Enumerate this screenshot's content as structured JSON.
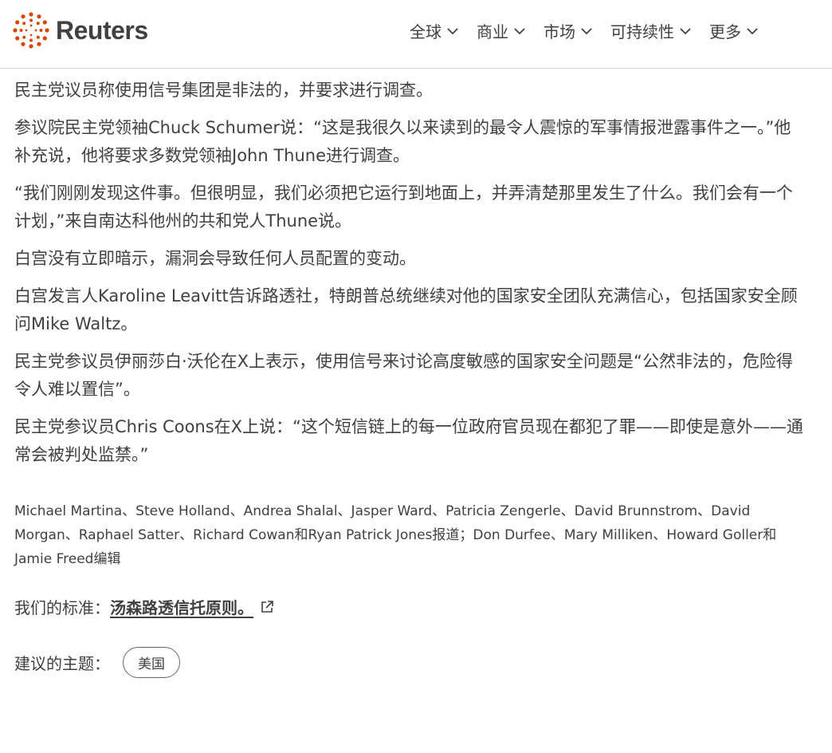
{
  "header": {
    "logo_text": "Reuters",
    "brand_color": "#dc4405",
    "nav": [
      {
        "label": "全球"
      },
      {
        "label": "商业"
      },
      {
        "label": "市场"
      },
      {
        "label": "可持续性"
      },
      {
        "label": "更多"
      }
    ]
  },
  "article": {
    "paragraphs": [
      "民主党议员称使用信号集团是非法的，并要求进行调查。",
      "参议院民主党领袖Chuck Schumer说：“这是我很久以来读到的最令人震惊的军事情报泄露事件之一。”他补充说，他将要求多数党领袖John Thune进行调查。",
      "“我们刚刚发现这件事。但很明显，我们必须把它运行到地面上，并弄清楚那里发生了什么。我们会有一个计划，”来自南达科他州的共和党人Thune说。",
      "白宫没有立即暗示，漏洞会导致任何人员配置的变动。",
      "白宫发言人Karoline Leavitt告诉路透社，特朗普总统继续对他的国家安全团队充满信心，包括国家安全顾问Mike Waltz。",
      "民主党参议员伊丽莎白·沃伦在X上表示，使用信号来讨论高度敏感的国家安全问题是“公然非法的，危险得令人难以置信”。",
      "民主党参议员Chris Coons在X上说：“这个短信链上的每一位政府官员现在都犯了罪——即使是意外——通常会被判处监禁。”"
    ],
    "credits": "Michael Martina、Steve Holland、Andrea Shalal、Jasper Ward、Patricia Zengerle、David Brunnstrom、David Morgan、Raphael Satter、Richard Cowan和Ryan Patrick Jones报道；Don Durfee、Mary Milliken、Howard Goller和Jamie Freed编辑",
    "standards_label": "我们的标准：",
    "standards_link": "汤森路透信托原则。",
    "external_link_icon": "external-link-icon",
    "topics_label": "建议的主题：",
    "topic_tag": "美国"
  }
}
